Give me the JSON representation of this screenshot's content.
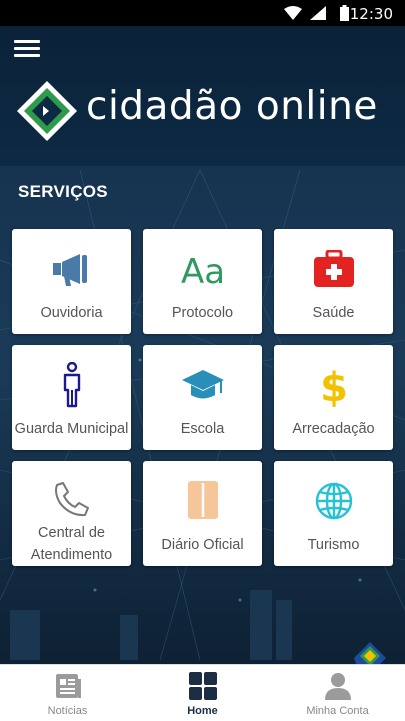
{
  "status_bar": {
    "time": "12:30"
  },
  "header": {
    "app_name": "cidadão online"
  },
  "services": {
    "title": "SERVIÇOS",
    "items": [
      {
        "label": "Ouvidoria",
        "icon": "megaphone-icon",
        "color": "#4a7aa8"
      },
      {
        "label": "Protocolo",
        "icon": "text-aa-icon",
        "color": "#2e9a5e"
      },
      {
        "label": "Saúde",
        "icon": "first-aid-kit-icon",
        "color": "#e32222"
      },
      {
        "label": "Guarda Municipal",
        "icon": "person-icon",
        "color": "#1a1a8c"
      },
      {
        "label": "Escola",
        "icon": "graduation-cap-icon",
        "color": "#2a8fb8"
      },
      {
        "label": "Arrecadação",
        "icon": "dollar-sign-icon",
        "color": "#f2c200"
      },
      {
        "label": "Central de",
        "label2": "Atendimento",
        "icon": "phone-icon",
        "color": "#777777"
      },
      {
        "label": "Diário Oficial",
        "icon": "book-icon",
        "color": "#f7c59a"
      },
      {
        "label": "Turismo",
        "icon": "globe-icon",
        "color": "#25c2d4"
      }
    ]
  },
  "bottom_nav": {
    "items": [
      {
        "label": "Notícias",
        "icon": "newspaper-icon"
      },
      {
        "label": "Home",
        "icon": "grid-icon",
        "active": true
      },
      {
        "label": "Minha Conta",
        "icon": "user-icon"
      }
    ]
  }
}
